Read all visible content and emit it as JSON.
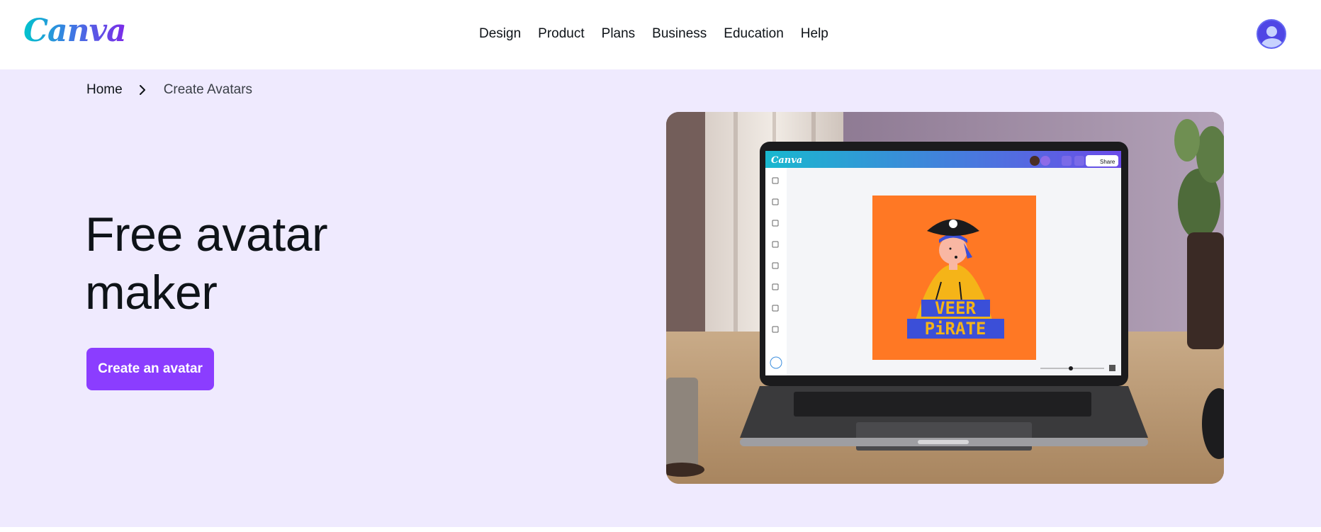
{
  "header": {
    "logo_text": "Canva",
    "nav": [
      "Design",
      "Product",
      "Plans",
      "Business",
      "Education",
      "Help"
    ]
  },
  "breadcrumb": {
    "home": "Home",
    "current": "Create Avatars"
  },
  "hero": {
    "title": "Free avatar maker",
    "cta_label": "Create an avatar"
  },
  "illustration": {
    "app_logo": "Canva",
    "share_label": "Share",
    "poster_line1": "VEER",
    "poster_line2": "PiRATE"
  },
  "colors": {
    "brand_purple": "#8b3dff",
    "hero_bg": "#efeafe",
    "poster_orange": "#ff7824"
  }
}
